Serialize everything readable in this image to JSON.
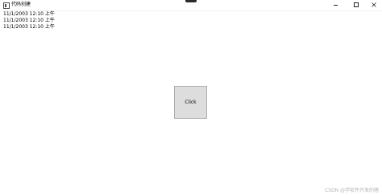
{
  "window": {
    "title": "代码创建"
  },
  "log": {
    "lines": [
      "11/1/2003 12:10 上午",
      "11/1/2003 12:10 上午",
      "11/1/2003 12:10 上午"
    ]
  },
  "main": {
    "button_label": "Click"
  },
  "watermark": {
    "text": "CSDN @学软件开发的猪"
  },
  "icons": {
    "app": "app-window-icon",
    "minimize": "minimize-icon",
    "maximize": "maximize-icon",
    "close": "close-icon"
  },
  "colors": {
    "button_bg": "#dddddd",
    "button_border": "#adadad",
    "watermark": "#b5b5b5"
  }
}
